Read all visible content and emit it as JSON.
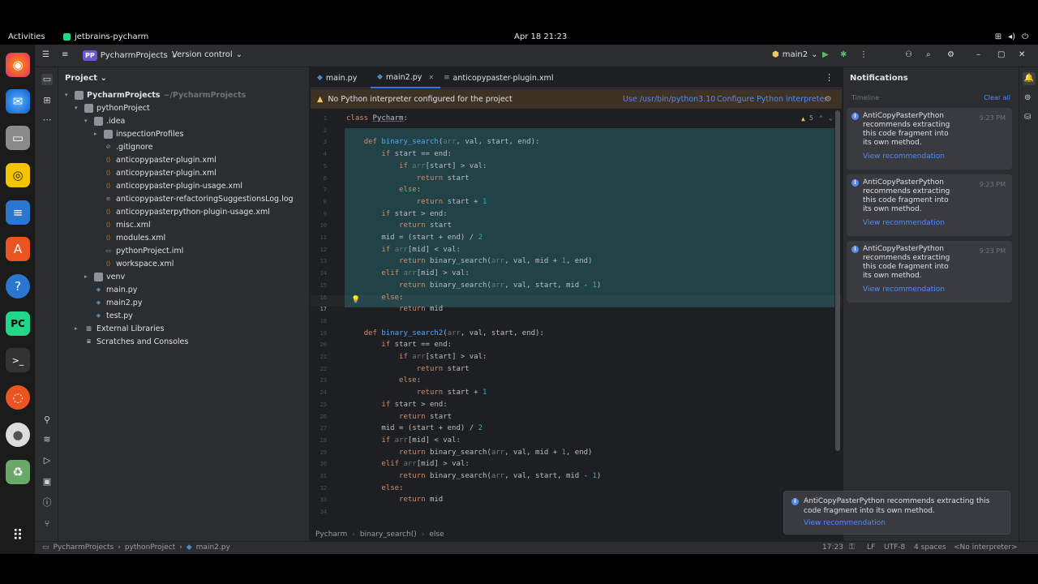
{
  "topbar": {
    "activities": "Activities",
    "app_name": "jetbrains-pycharm",
    "clock": "Apr 18  21:23"
  },
  "ide": {
    "project_badge": "PP",
    "project_name": "PycharmProjects",
    "vcs": "Version control",
    "branch": "main2"
  },
  "project_panel": {
    "title": "Project",
    "tree": [
      {
        "label": "PycharmProjects",
        "extra": "~/PycharmProjects",
        "depth": 0,
        "arrow": "▾",
        "icon": "folder-icon"
      },
      {
        "label": "pythonProject",
        "extra": "",
        "depth": 1,
        "arrow": "▾",
        "icon": "folder-icon"
      },
      {
        "label": ".idea",
        "extra": "",
        "depth": 2,
        "arrow": "▾",
        "icon": "folder-icon"
      },
      {
        "label": "inspectionProfiles",
        "extra": "",
        "depth": 3,
        "arrow": "▸",
        "icon": "folder-icon"
      },
      {
        "label": ".gitignore",
        "extra": "",
        "depth": 3,
        "arrow": "",
        "icon": "ignore-file-icon"
      },
      {
        "label": "anticopypaster-plugin.xml",
        "extra": "",
        "depth": 3,
        "arrow": "",
        "icon": "xml-file-icon"
      },
      {
        "label": "anticopypaster-plugin.xml",
        "extra": "",
        "depth": 3,
        "arrow": "",
        "icon": "xml-file-icon"
      },
      {
        "label": "anticopypaster-plugin-usage.xml",
        "extra": "",
        "depth": 3,
        "arrow": "",
        "icon": "xml-file-icon"
      },
      {
        "label": "anticopypaster-refactoringSuggestionsLog.log",
        "extra": "",
        "depth": 3,
        "arrow": "",
        "icon": "log-file-icon"
      },
      {
        "label": "anticopypasterpython-plugin-usage.xml",
        "extra": "",
        "depth": 3,
        "arrow": "",
        "icon": "xml-file-icon"
      },
      {
        "label": "misc.xml",
        "extra": "",
        "depth": 3,
        "arrow": "",
        "icon": "xml-file-icon"
      },
      {
        "label": "modules.xml",
        "extra": "",
        "depth": 3,
        "arrow": "",
        "icon": "xml-file-icon"
      },
      {
        "label": "pythonProject.iml",
        "extra": "",
        "depth": 3,
        "arrow": "",
        "icon": "iml-file-icon"
      },
      {
        "label": "workspace.xml",
        "extra": "",
        "depth": 3,
        "arrow": "",
        "icon": "xml-file-icon"
      },
      {
        "label": "venv",
        "extra": "",
        "depth": 2,
        "arrow": "▸",
        "icon": "folder-icon"
      },
      {
        "label": "main.py",
        "extra": "",
        "depth": 2,
        "arrow": "",
        "icon": "python-file-icon"
      },
      {
        "label": "main2.py",
        "extra": "",
        "depth": 2,
        "arrow": "",
        "icon": "python-file-icon"
      },
      {
        "label": "test.py",
        "extra": "",
        "depth": 2,
        "arrow": "",
        "icon": "python-file-icon"
      },
      {
        "label": "External Libraries",
        "extra": "",
        "depth": 1,
        "arrow": "▸",
        "icon": "library-icon"
      },
      {
        "label": "Scratches and Consoles",
        "extra": "",
        "depth": 1,
        "arrow": "",
        "icon": "scratch-icon"
      }
    ]
  },
  "tabs": [
    {
      "label": "main.py",
      "active": false
    },
    {
      "label": "main2.py",
      "active": true
    },
    {
      "label": "anticopypaster-plugin.xml",
      "active": false
    }
  ],
  "warning": {
    "text": "No Python interpreter configured for the project",
    "action1": "Use /usr/bin/python3.10",
    "action2": "Configure Python interpreter"
  },
  "inspections": {
    "count": "5"
  },
  "code": {
    "lines": [
      {
        "n": "1",
        "html": "<span class=\"kw\">class</span> <span class=\"cls\">Pycharm</span>:"
      },
      {
        "n": "2",
        "html": ""
      },
      {
        "n": "3",
        "html": "    <span class=\"kw\">def</span> <span class=\"fn\">binary_search</span>(<span class=\"par\">arr</span>, val, start, end):"
      },
      {
        "n": "4",
        "html": "        <span class=\"kw\">if</span> start == end:"
      },
      {
        "n": "5",
        "html": "            <span class=\"kw\">if</span> <span class=\"par\">arr</span>[start] > val:"
      },
      {
        "n": "6",
        "html": "                <span class=\"kw\">return</span> start"
      },
      {
        "n": "7",
        "html": "            <span class=\"kw\">else</span>:"
      },
      {
        "n": "8",
        "html": "                <span class=\"kw\">return</span> start + <span class=\"num\">1</span>"
      },
      {
        "n": "9",
        "html": "        <span class=\"kw\">if</span> start > end:"
      },
      {
        "n": "10",
        "html": "            <span class=\"kw\">return</span> start"
      },
      {
        "n": "11",
        "html": "        mid = (start + end) / <span class=\"num\">2</span>"
      },
      {
        "n": "12",
        "html": "        <span class=\"kw\">if</span> <span class=\"par\">arr</span>[mid] < val:"
      },
      {
        "n": "13",
        "html": "            <span class=\"kw\">return</span> binary_search(<span class=\"par\">arr</span>, val, mid + <span class=\"num\">1</span>, end)"
      },
      {
        "n": "14",
        "html": "        <span class=\"kw\">elif</span> <span class=\"par\">arr</span>[mid] > val:"
      },
      {
        "n": "15",
        "html": "            <span class=\"kw\">return</span> binary_search(<span class=\"par\">arr</span>, val, start, mid - <span class=\"num\">1</span>)"
      },
      {
        "n": "16",
        "html": "        <span class=\"kw\">else</span>:"
      },
      {
        "n": "17",
        "html": "            <span class=\"kw\">return</span> mid"
      },
      {
        "n": "18",
        "html": ""
      },
      {
        "n": "19",
        "html": "    <span class=\"kw\">def</span> <span class=\"fn\">binary_search2</span>(<span class=\"par\">arr</span>, val, start, end):"
      },
      {
        "n": "20",
        "html": "        <span class=\"kw\">if</span> start == end:"
      },
      {
        "n": "21",
        "html": "            <span class=\"kw\">if</span> <span class=\"par\">arr</span>[start] > val:"
      },
      {
        "n": "22",
        "html": "                <span class=\"kw\">return</span> start"
      },
      {
        "n": "23",
        "html": "            <span class=\"kw\">else</span>:"
      },
      {
        "n": "24",
        "html": "                <span class=\"kw\">return</span> start + <span class=\"num\">1</span>"
      },
      {
        "n": "25",
        "html": "        <span class=\"kw\">if</span> start > end:"
      },
      {
        "n": "26",
        "html": "            <span class=\"kw\">return</span> start"
      },
      {
        "n": "27",
        "html": "        mid = (start + end) / <span class=\"num\">2</span>"
      },
      {
        "n": "28",
        "html": "        <span class=\"kw\">if</span> <span class=\"par\">arr</span>[mid] < val:"
      },
      {
        "n": "29",
        "html": "            <span class=\"kw\">return</span> binary_search(<span class=\"par\">arr</span>, val, mid + <span class=\"num\">1</span>, end)"
      },
      {
        "n": "30",
        "html": "        <span class=\"kw\">elif</span> <span class=\"par\">arr</span>[mid] > val:"
      },
      {
        "n": "31",
        "html": "            <span class=\"kw\">return</span> binary_search(<span class=\"par\">arr</span>, val, start, mid - <span class=\"num\">1</span>)"
      },
      {
        "n": "32",
        "html": "        <span class=\"kw\">else</span>:"
      },
      {
        "n": "33",
        "html": "            <span class=\"kw\">return</span> mid"
      },
      {
        "n": "34",
        "html": ""
      }
    ]
  },
  "breadcrumb": [
    "Pycharm",
    "binary_search()",
    "else"
  ],
  "notifications": {
    "title": "Notifications",
    "timeline": "Timeline",
    "clear_all": "Clear all",
    "items": [
      {
        "title": "AntiCopyPasterPython",
        "body": "recommends extracting this code fragment into its own method.",
        "link": "View recommendation",
        "time": "9:23 PM"
      },
      {
        "title": "AntiCopyPasterPython",
        "body": "recommends extracting this code fragment into its own method.",
        "link": "View recommendation",
        "time": "9:23 PM"
      },
      {
        "title": "AntiCopyPasterPython",
        "body": "recommends extracting this code fragment into its own method.",
        "link": "View recommendation",
        "time": "9:23 PM"
      }
    ]
  },
  "toast": {
    "text": "AntiCopyPasterPython recommends extracting this code fragment into its own method.",
    "link": "View recommendation"
  },
  "statusbar": {
    "path": [
      "PycharmProjects",
      "pythonProject",
      "main2.py"
    ],
    "position": "17:23",
    "line_sep": "LF",
    "encoding": "UTF-8",
    "indent": "4 spaces",
    "interpreter": "<No interpreter>"
  },
  "colors": {
    "accent": "#3574f0",
    "selection": "#214247",
    "warning_bg": "#3d3223"
  }
}
